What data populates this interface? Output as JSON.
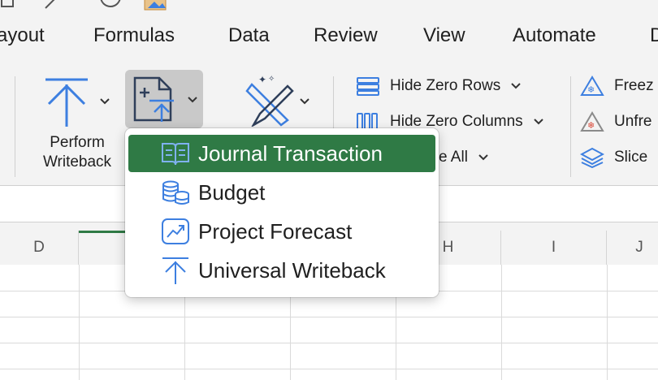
{
  "tabs": [
    "ayout",
    "Formulas",
    "Data",
    "Review",
    "View",
    "Automate",
    "D"
  ],
  "ribbon": {
    "perform_writeback": {
      "line1": "Perform",
      "line2": "Writeback"
    },
    "hide_zero_rows": "Hide Zero Rows",
    "hide_zero_columns": "Hide Zero Columns",
    "hide_all_partial": "e All",
    "freeze_partial": "Freez",
    "unfreeze_partial": "Unfre",
    "slice_partial": "Slice"
  },
  "grid": {
    "columns": [
      "D",
      "",
      "",
      "",
      "H",
      "I",
      "J"
    ]
  },
  "menu": {
    "items": [
      {
        "label": "Journal Transaction",
        "icon": "journal-icon",
        "selected": true
      },
      {
        "label": "Budget",
        "icon": "budget-database-icon",
        "selected": false
      },
      {
        "label": "Project Forecast",
        "icon": "forecast-chart-icon",
        "selected": false
      },
      {
        "label": "Universal Writeback",
        "icon": "writeback-arrow-icon",
        "selected": false
      }
    ]
  },
  "colors": {
    "accent": "#2f7a45",
    "icon_blue": "#3d7fe0",
    "icon_red": "#d94a3a"
  }
}
